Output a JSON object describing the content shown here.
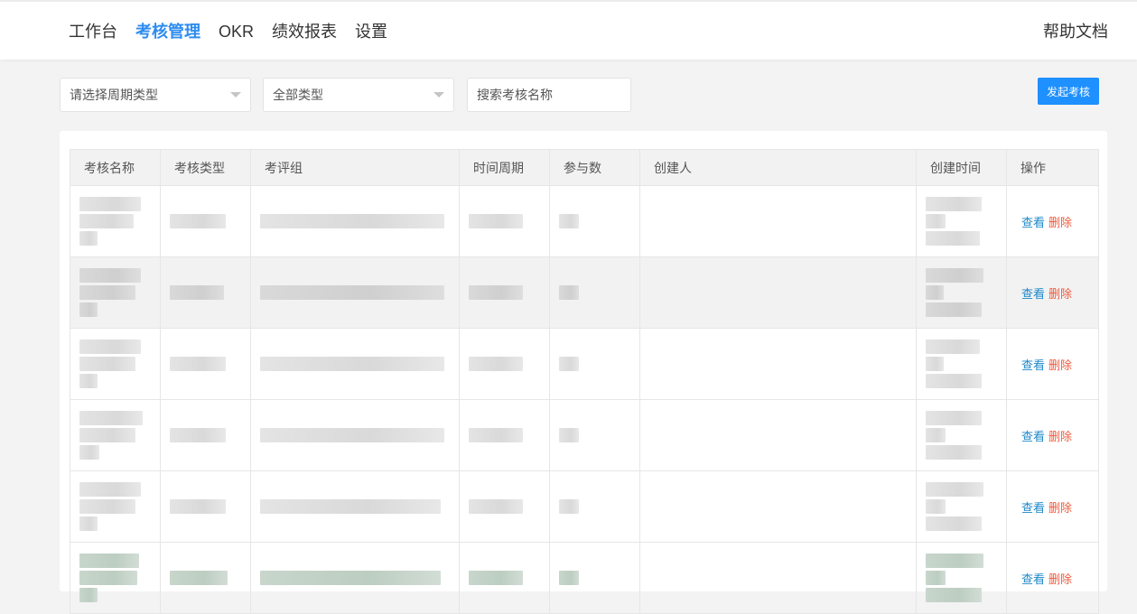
{
  "nav": {
    "items": [
      {
        "label": "工作台"
      },
      {
        "label": "考核管理",
        "active": true
      },
      {
        "label": "OKR"
      },
      {
        "label": "绩效报表"
      },
      {
        "label": "设置"
      }
    ],
    "help": "帮助文档"
  },
  "filters": {
    "cycle_type": "请选择周期类型",
    "all_types": "全部类型",
    "search_placeholder": "搜索考核名称",
    "start_button": "发起考核"
  },
  "table": {
    "headers": [
      "考核名称",
      "考核类型",
      "考评组",
      "时间周期",
      "参与数",
      "创建人",
      "创建时间",
      "操作"
    ],
    "rows": 6,
    "view_label": "查看",
    "delete_label": "删除"
  },
  "colors": {
    "accent": "#2d8cf0",
    "primary_button": "#1e90ff",
    "view_link": "#1e88c9",
    "delete_link": "#f05a3c"
  }
}
